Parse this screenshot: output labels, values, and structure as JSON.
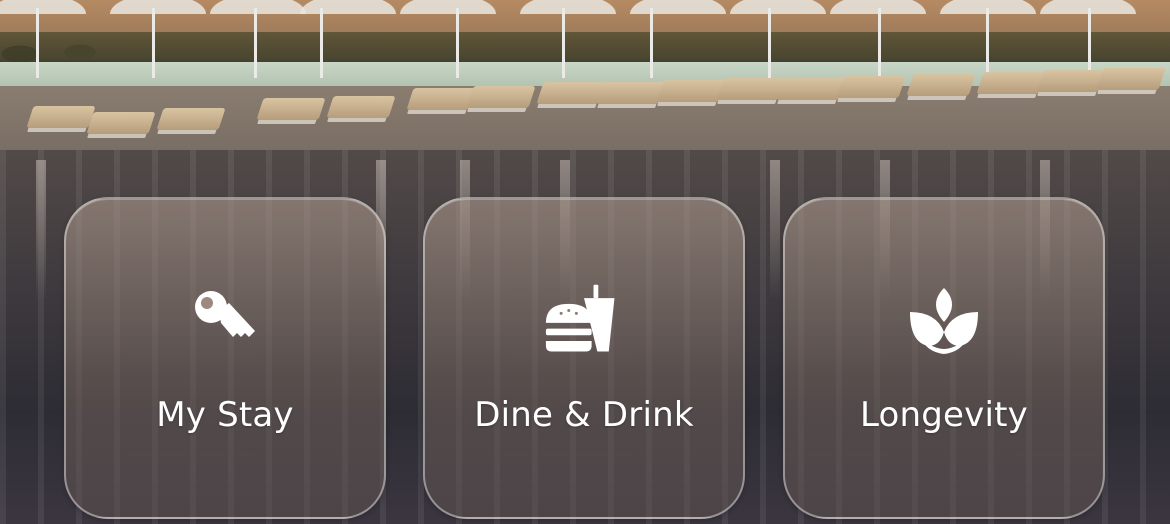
{
  "tiles": [
    {
      "label": "My Stay",
      "icon": "key-icon"
    },
    {
      "label": "Dine & Drink",
      "icon": "burger-drink-icon"
    },
    {
      "label": "Longevity",
      "icon": "lotus-icon"
    }
  ],
  "colors": {
    "tile_text": "#ffffff",
    "tile_border": "rgba(255,255,255,0.42)"
  }
}
